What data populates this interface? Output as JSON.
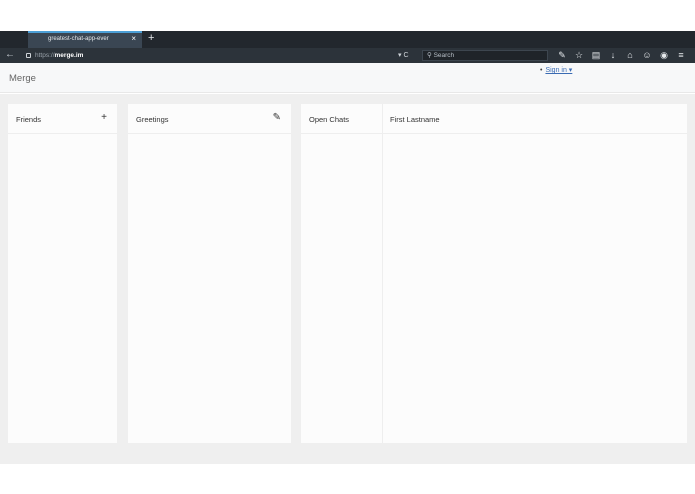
{
  "browser": {
    "tab_title": "greatest-chat-app-ever",
    "tab_close": "×",
    "new_tab": "+",
    "url_prefix": "https://",
    "url_host": "merge.im",
    "url_controls": "▾ C",
    "search_placeholder": "Search",
    "toolbar_icons": [
      "wrench-icon",
      "star-icon",
      "clipboard-icon",
      "download-icon",
      "home-icon",
      "smiley-icon",
      "shield-icon",
      "menu-icon"
    ]
  },
  "app": {
    "brand": "Merge",
    "signin_label": "Sign in ▾"
  },
  "panels": {
    "friends": {
      "title": "Friends",
      "action": "+"
    },
    "greetings": {
      "title": "Greetings",
      "action": "✎"
    },
    "chats": {
      "title": "Open Chats",
      "active_chat_name": "First Lastname"
    }
  }
}
